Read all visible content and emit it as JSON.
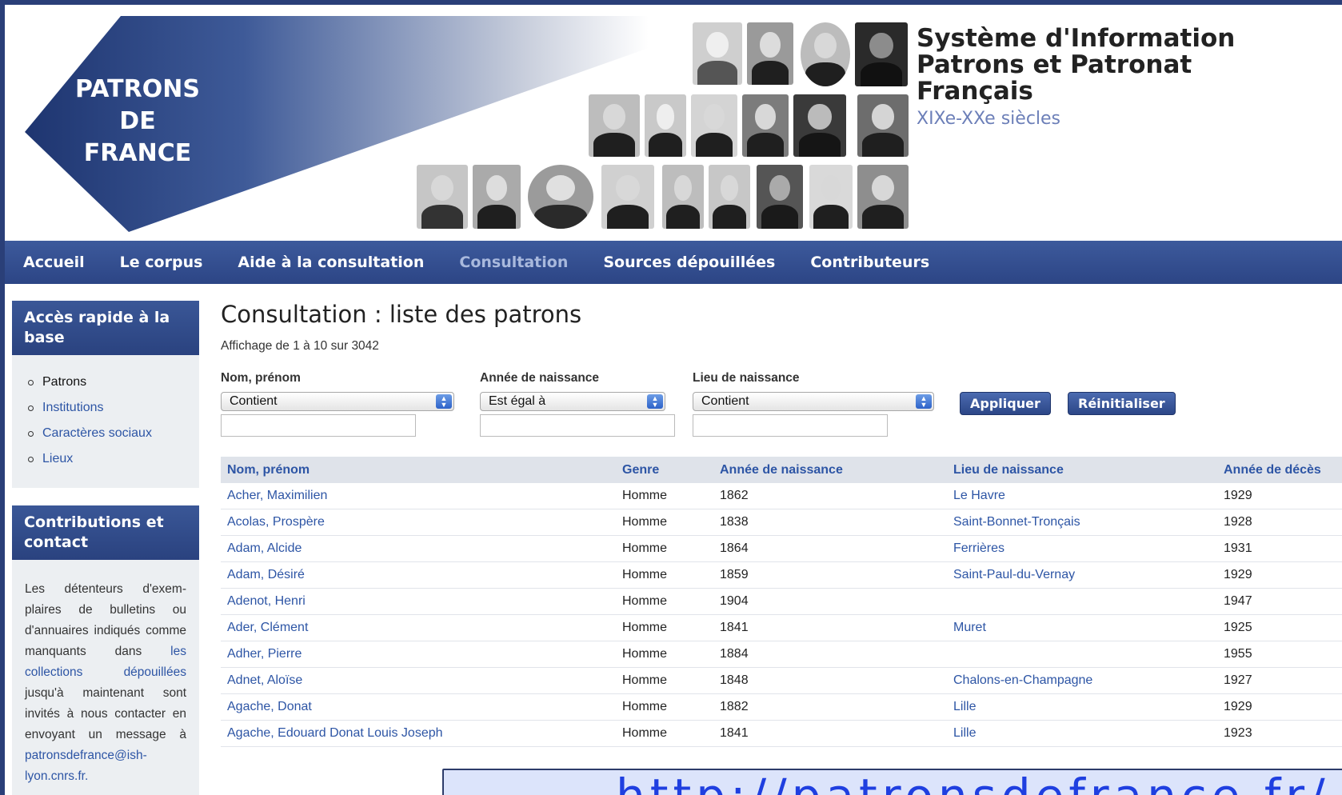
{
  "header": {
    "logo_lines": [
      "PATRONS",
      "DE",
      "FRANCE"
    ],
    "title_lines": [
      "Système d'Information",
      "Patrons et Patronat",
      "Français"
    ],
    "subtitle": "XIXe-XXe siècles"
  },
  "nav": {
    "items": [
      {
        "label": "Accueil",
        "active": false
      },
      {
        "label": "Le corpus",
        "active": false
      },
      {
        "label": "Aide à la consultation",
        "active": false
      },
      {
        "label": "Consultation",
        "active": true
      },
      {
        "label": "Sources dépouillées",
        "active": false
      },
      {
        "label": "Contributeurs",
        "active": false
      }
    ]
  },
  "sidebar": {
    "quick_access": {
      "title": "Accès rapide à la base",
      "items": [
        "Patrons",
        "Institutions",
        "Caractères sociaux",
        "Lieux"
      ]
    },
    "contributions": {
      "title": "Contributions et contact",
      "text_before": "Les détenteurs d'exem-plaires de bulletins ou d'annuaires indiqués comme manquants dans ",
      "link_text": "les collections dépouillées",
      "text_after": " jusqu'à maintenant sont invités à nous contacter en envoyant un message à ",
      "email": "patronsdefrance@ish-lyon.cnrs.fr."
    }
  },
  "main": {
    "title": "Consultation : liste des patrons",
    "paging": "Affichage de 1 à 10 sur 3042",
    "filters": [
      {
        "label": "Nom, prénom",
        "select_value": "Contient",
        "input_value": ""
      },
      {
        "label": "Année de naissance",
        "select_value": "Est égal à",
        "input_value": ""
      },
      {
        "label": "Lieu de naissance",
        "select_value": "Contient",
        "input_value": ""
      }
    ],
    "apply_label": "Appliquer",
    "reset_label": "Réinitialiser",
    "table": {
      "headers": [
        "Nom, prénom",
        "Genre",
        "Année de naissance",
        "Lieu de naissance",
        "Année de décès"
      ],
      "rows": [
        [
          "Acher, Maximilien",
          "Homme",
          "1862",
          "Le Havre",
          "1929"
        ],
        [
          "Acolas, Prospère",
          "Homme",
          "1838",
          "Saint-Bonnet-Tronçais",
          "1928"
        ],
        [
          "Adam, Alcide",
          "Homme",
          "1864",
          "Ferrières",
          "1931"
        ],
        [
          "Adam, Désiré",
          "Homme",
          "1859",
          "Saint-Paul-du-Vernay",
          "1929"
        ],
        [
          "Adenot, Henri",
          "Homme",
          "1904",
          "",
          "1947"
        ],
        [
          "Ader, Clément",
          "Homme",
          "1841",
          "Muret",
          "1925"
        ],
        [
          "Adher, Pierre",
          "Homme",
          "1884",
          "",
          "1955"
        ],
        [
          "Adnet, Aloïse",
          "Homme",
          "1848",
          "Chalons-en-Champagne",
          "1927"
        ],
        [
          "Agache, Donat",
          "Homme",
          "1882",
          "Lille",
          "1929"
        ],
        [
          "Agache, Edouard Donat Louis Joseph",
          "Homme",
          "1841",
          "Lille",
          "1923"
        ]
      ]
    }
  },
  "overlay": {
    "url": "http://patronsdefrance.fr/"
  },
  "colors": {
    "nav_blue": "#2c4585",
    "link_blue": "#2d55a5",
    "frame": "#2a3f78"
  }
}
